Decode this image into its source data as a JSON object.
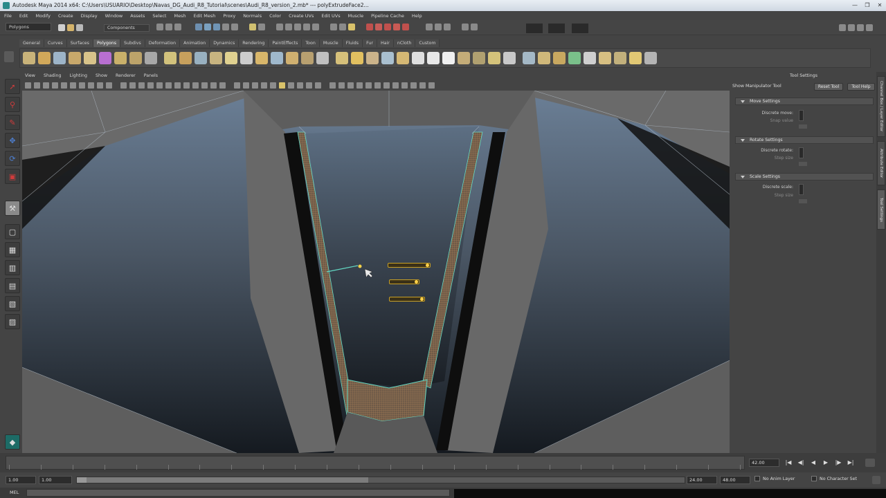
{
  "window": {
    "title": "Autodesk Maya 2014 x64: C:\\Users\\USUARIO\\Desktop\\Navas_DG_Audi_R8_Tutorial\\scenes\\Audi_R8_version_2.mb*  ---  polyExtrudeFace2...",
    "controls": [
      "—",
      "❐",
      "✕"
    ]
  },
  "menubar": {
    "items": [
      "File",
      "Edit",
      "Modify",
      "Create",
      "Display",
      "Window",
      "Assets",
      "Select",
      "Mesh",
      "Edit Mesh",
      "Proxy",
      "Normals",
      "Color",
      "Create UVs",
      "Edit UVs",
      "Muscle",
      "Pipeline Cache",
      "Help"
    ]
  },
  "statusline": {
    "mode_selector": "Polygons",
    "component_label": "Components"
  },
  "shelf": {
    "tabs": [
      "General",
      "Curves",
      "Surfaces",
      "Polygons",
      "Subdivs",
      "Deformation",
      "Animation",
      "Dynamics",
      "Rendering",
      "PaintEffects",
      "Toon",
      "Muscle",
      "Fluids",
      "Fur",
      "Hair",
      "nCloth",
      "Custom"
    ],
    "active_tab": "Polygons",
    "icon_colors": [
      "#c9b37a",
      "#d1a85a",
      "#9db4c8",
      "#c8a86b",
      "#d8c38a",
      "#b86fd1",
      "#c9b06a",
      "#bca36a",
      "#a8a8a8",
      "#d2c27c",
      "#c7a05d",
      "#98b0c0",
      "#c8b480",
      "#e0d190",
      "#cccccc",
      "#d8b66a",
      "#9fb8cc",
      "#d0b070",
      "#b8a070",
      "#c0c0c0",
      "#d6c07a",
      "#e2c060",
      "#cbb38a",
      "#a9bfcf",
      "#d5b874",
      "#dfdfdf",
      "#e8e8e8",
      "#f0f0f0",
      "#c4ac78",
      "#b0a070",
      "#d4c27a",
      "#c9c9c9",
      "#a4b8c6",
      "#d0b87a",
      "#c8a860",
      "#7ac08a",
      "#cfcfcf",
      "#d7bf82",
      "#c2b07c",
      "#e1c874",
      "#b4b4b4"
    ]
  },
  "viewport": {
    "menu": [
      "View",
      "Shading",
      "Lighting",
      "Show",
      "Renderer",
      "Panels"
    ]
  },
  "toolsettings": {
    "header": "Tool Settings",
    "tool_name": "Show Manipulator Tool",
    "reset_label": "Reset Tool",
    "help_label": "Tool Help",
    "sections": [
      {
        "title": "Move Settings",
        "label": "Discrete move:",
        "dim": "Snap value"
      },
      {
        "title": "Rotate Settings",
        "label": "Discrete rotate:",
        "dim": "Step size"
      },
      {
        "title": "Scale Settings",
        "label": "Discrete scale:",
        "dim": "Step size"
      }
    ]
  },
  "sidetabs": [
    "Channel Box / Layer Editor",
    "Attribute Editor",
    "Tool Settings"
  ],
  "timeline": {
    "ticks": [
      "2",
      "4",
      "6",
      "8",
      "10",
      "12",
      "14",
      "16",
      "18",
      "20",
      "22",
      "24"
    ],
    "current_frame": "42.00",
    "playback_buttons": [
      "|◀",
      "◀|",
      "◀",
      "▶",
      "|▶",
      "▶|"
    ]
  },
  "range": {
    "start": "1.00",
    "playback_start": "1.00",
    "playback_end": "24.00",
    "end": "48.00",
    "anim_layer": "No Anim Layer",
    "char_set": "No Character Set"
  },
  "command": {
    "label": "MEL"
  }
}
